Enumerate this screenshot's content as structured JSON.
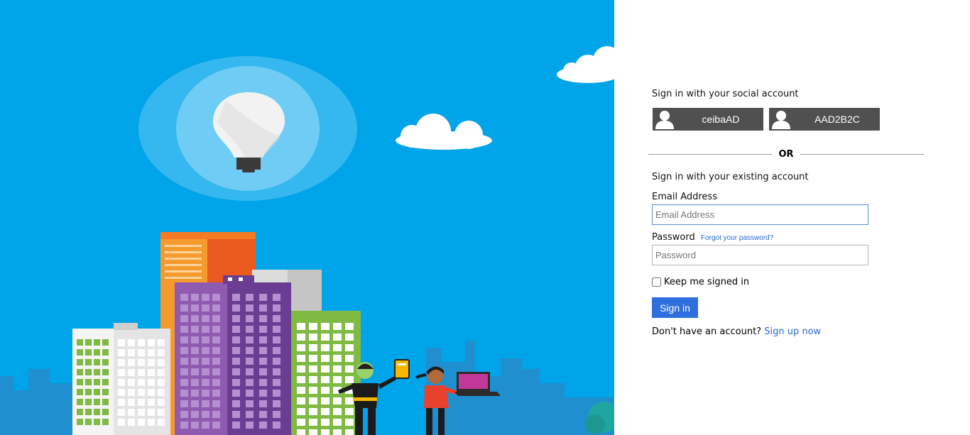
{
  "social": {
    "heading": "Sign in with your social account",
    "providers": [
      {
        "label": "ceibaAD",
        "icon": "user-icon"
      },
      {
        "label": "AAD2B2C",
        "icon": "user-icon"
      }
    ]
  },
  "divider": {
    "text": "OR"
  },
  "local": {
    "heading": "Sign in with your existing account",
    "email_label": "Email Address",
    "email_placeholder": "Email Address",
    "password_label": "Password",
    "password_placeholder": "Password",
    "forgot_link": "Forgot your password?",
    "keep_signed_in": "Keep me signed in",
    "signin_button": "Sign in",
    "no_account_text": "Don't have an account?",
    "signup_link": "Sign up now"
  },
  "colors": {
    "hero_background": "#00a4e8",
    "social_button": "#505050",
    "primary_button": "#2f6fdd",
    "link": "#2b6cc9"
  }
}
